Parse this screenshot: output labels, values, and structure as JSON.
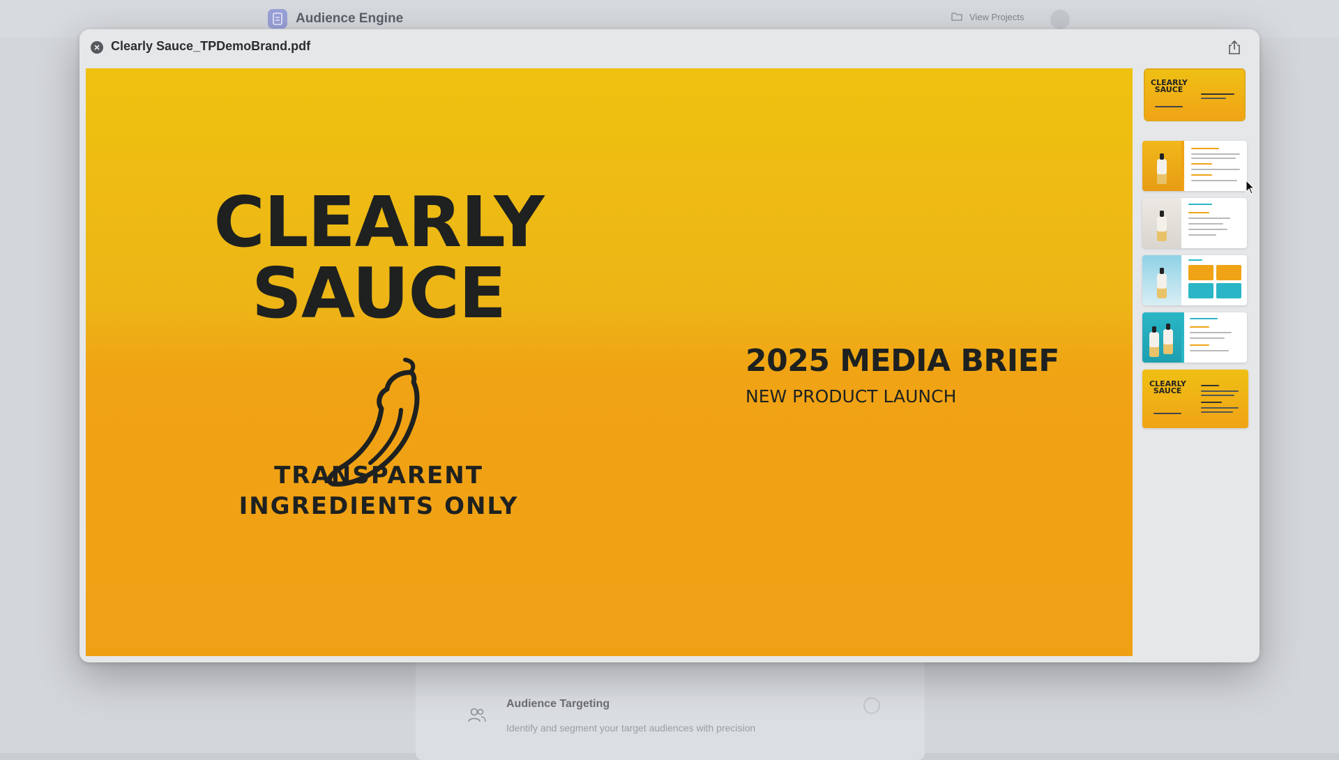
{
  "background_app": {
    "brand_name": "Audience Engine",
    "view_projects_label": "View Projects",
    "card_title": "Audience Targeting",
    "card_description": "Identify and segment your target audiences with precision"
  },
  "viewer": {
    "file_name": "Clearly Sauce_TPDemoBrand.pdf"
  },
  "slide": {
    "brand_line1": "CLEARLY",
    "brand_line2": "SAUCE",
    "tagline_line1": "TRANSPARENT",
    "tagline_line2": "INGREDIENTS ONLY",
    "heading": "2025 MEDIA BRIEF",
    "subheading": "NEW PRODUCT LAUNCH",
    "colors": {
      "background_top": "#eec10f",
      "background_bottom": "#f0a015",
      "ink": "#1e2120"
    }
  },
  "thumbnails": {
    "first_title_line1": "CLEARLY",
    "first_title_line2": "SAUCE",
    "last_title_line1": "CLEARLY",
    "last_title_line2": "SAUCE",
    "selected_page": 1,
    "page_count": 6
  },
  "icons": {
    "close": "close-icon",
    "share": "share-icon",
    "brand": "document-icon",
    "folder": "folder-icon",
    "audience": "users-icon"
  }
}
